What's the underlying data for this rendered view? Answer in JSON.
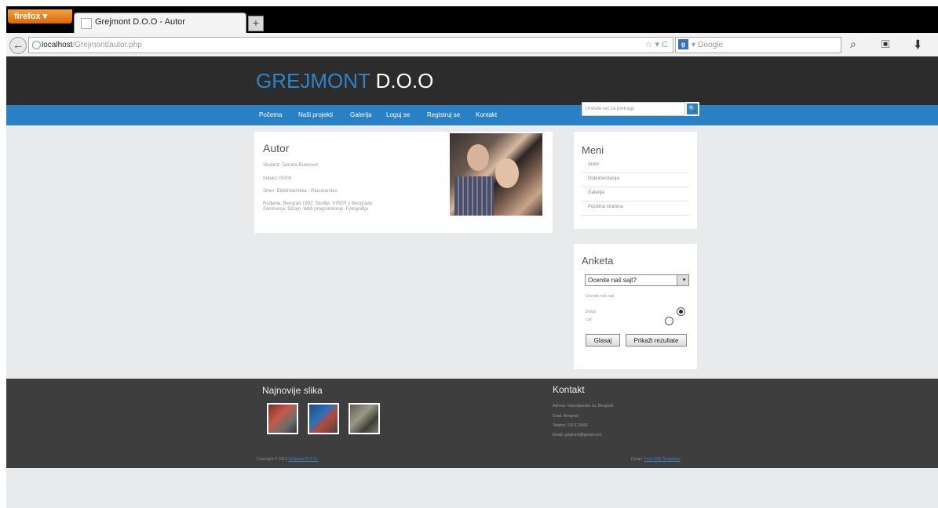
{
  "browser": {
    "app_button": "firefox ▾",
    "tab_title": "Grejmont D.O.O - Autor",
    "new_tab": "+",
    "url_host": "localhost",
    "url_path": "/Grejmont/autor.php",
    "url_icons": "☆ ▾ C",
    "search_engine": "g",
    "search_placeholder": "▾ Google",
    "toolbar_icons": "⌕ ▣ ⬇ ⌂"
  },
  "site": {
    "logo_part1": "GREJMONT",
    "logo_part2": " D.O.O",
    "menu": [
      "Početna",
      "Naši projekti",
      "Galerija",
      "Loguj se",
      "Registruj se",
      "Kontakt"
    ],
    "search_placeholder": "Unesite rec za pretragu",
    "search_button": "🔍"
  },
  "autor": {
    "title": "Autor",
    "lines": [
      "Student: Tamara Bundovic",
      "Indeks: 00/00",
      "Smer: Elektrotehnika - Racunarstvo",
      "Rodjena: Beograd 1992, Studije: VIŠER u Beogradu",
      "Zanimanja: Dizajn, Web programiranje, Fotografija"
    ]
  },
  "meni": {
    "title": "Meni",
    "items": [
      "Autor",
      "Dokumentacija",
      "Galerija",
      "Pocetna stranica"
    ]
  },
  "anketa": {
    "title": "Anketa",
    "select_value": "Ocenite naš sajt?",
    "select_arrow": "▾",
    "question": "Ocenite naš sajt",
    "options": [
      "Dobar",
      "Loš"
    ],
    "vote_button": "Glasaj",
    "results_button": "Prikaži rezultate"
  },
  "footer": {
    "najnovije_title": "Najnovije slika",
    "thumb_colors": [
      "#b34a3c",
      "#2d6fb8",
      "#7a7a6a"
    ],
    "kontakt_title": "Kontakt",
    "kontakt_lines": [
      "Adresa: Vojvodjanska 1a, Beograd",
      "Grad: Beograd",
      "Telefon: 011/123456",
      "Email: grejmont@gmail.com"
    ],
    "copyright_prefix": "Copyright © 2013 ",
    "copyright_link": "Grejmont D.O.O.",
    "design_prefix": "Dizajn: ",
    "design_link": "Free CSS Templates"
  },
  "colors": {
    "accent": "#2a80c4",
    "header": "#2c2c2c",
    "footer": "#3e3e3e",
    "page_bg": "#e9eaec"
  }
}
